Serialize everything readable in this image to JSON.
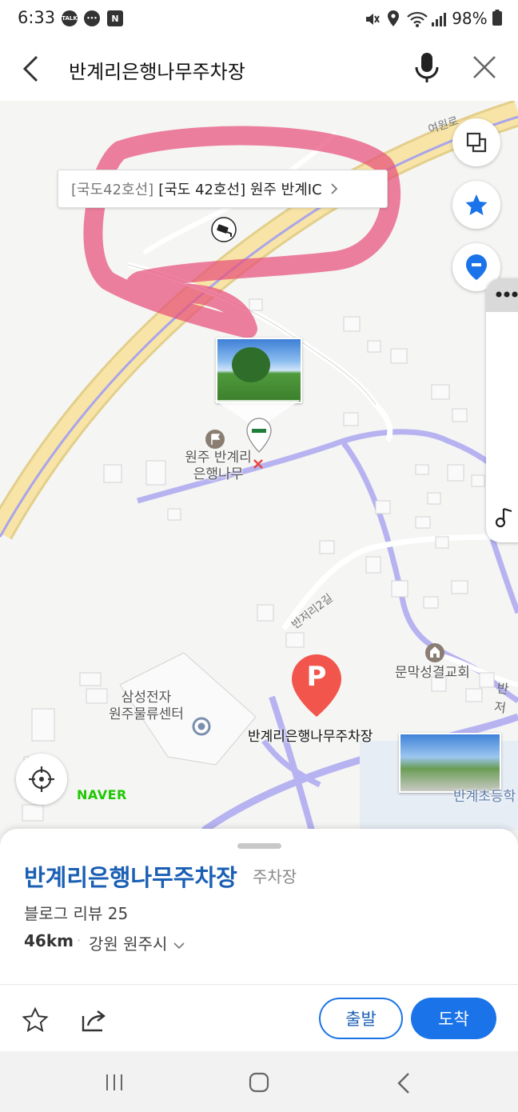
{
  "status_bar": {
    "time": "6:33",
    "badges": [
      "TALK",
      "•••",
      "N"
    ],
    "battery": "98%"
  },
  "search": {
    "query": "반계리은행나무주차장"
  },
  "map": {
    "road_label_top": "여원로",
    "tooltip": {
      "prefix": "[국도42호선]",
      "text": "[국도 42호선] 원주 반계IC"
    },
    "poi_tree_line1": "원주 반계리",
    "poi_tree_line2": "은행나무",
    "road_label_banjeo": "반저리2길",
    "church": "문막성결교회",
    "road_label_right": "반저",
    "samsung_line1": "삼성전자",
    "samsung_line2": "원주물류센터",
    "parking_label": "반계리은행나무주차장",
    "parking_marker": "P",
    "school": "반계초등학",
    "logo": "NAVER"
  },
  "place": {
    "name": "반계리은행나무주차장",
    "category": "주차장",
    "blog_review": "블로그 리뷰 25",
    "distance": "46km",
    "address": "강원 원주시"
  },
  "actions": {
    "depart": "출발",
    "arrive": "도착"
  },
  "colors": {
    "accent": "#1a73e8",
    "title": "#1a5fb4",
    "parking_marker": "#f2554c",
    "highway": "#f7e4a6",
    "local_road": "#b7b3f0",
    "annotation": "#e8507a"
  }
}
